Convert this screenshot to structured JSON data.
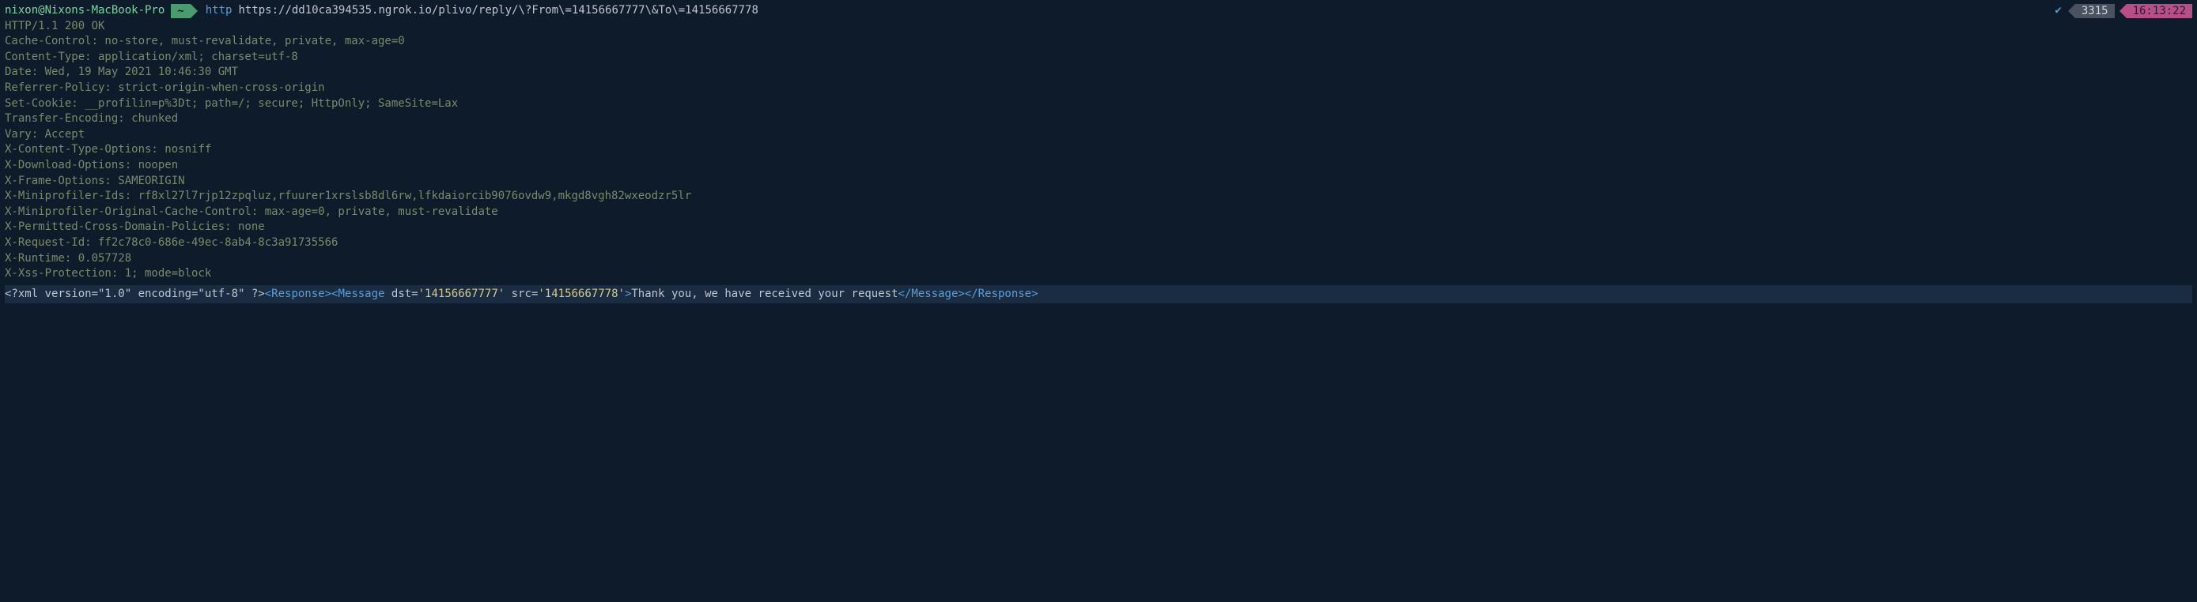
{
  "prompt": {
    "userhost": "nixon@Nixons-MacBook-Pro",
    "cwd": "~",
    "command": "http",
    "url": "https://dd10ca394535.ngrok.io/plivo/reply/\\?From\\=14156667777\\&To\\=14156667778",
    "check": "✔",
    "session_id": "3315",
    "time": "16:13:22"
  },
  "headers": {
    "status": "HTTP/1.1 200 OK",
    "cache_control": "Cache-Control: no-store, must-revalidate, private, max-age=0",
    "content_type": "Content-Type: application/xml; charset=utf-8",
    "date": "Date: Wed, 19 May 2021 10:46:30 GMT",
    "referrer_policy": "Referrer-Policy: strict-origin-when-cross-origin",
    "set_cookie": "Set-Cookie: __profilin=p%3Dt; path=/; secure; HttpOnly; SameSite=Lax",
    "transfer_encoding": "Transfer-Encoding: chunked",
    "vary": "Vary: Accept",
    "x_content_type_options": "X-Content-Type-Options: nosniff",
    "x_download_options": "X-Download-Options: noopen",
    "x_frame_options": "X-Frame-Options: SAMEORIGIN",
    "x_miniprofiler_ids": "X-Miniprofiler-Ids: rf8xl27l7rjp12zpqluz,rfuurer1xrslsb8dl6rw,lfkdaiorcib9076ovdw9,mkgd8vgh82wxeodzr5lr",
    "x_miniprofiler_original_cache_control": "X-Miniprofiler-Original-Cache-Control: max-age=0, private, must-revalidate",
    "x_permitted_cross_domain_policies": "X-Permitted-Cross-Domain-Policies: none",
    "x_request_id": "X-Request-Id: ff2c78c0-686e-49ec-8ab4-8c3a91735566",
    "x_runtime": "X-Runtime: 0.057728",
    "x_xss_protection": "X-Xss-Protection: 1; mode=block"
  },
  "xml": {
    "declaration": "<?xml version=\"1.0\" encoding=\"utf-8\" ?>",
    "response_open": "<Response>",
    "message_open": "<Message",
    "dst_attr": " dst=",
    "dst_val": "'14156667777'",
    "src_attr": " src=",
    "src_val": "'14156667778'",
    "close_angle": ">",
    "body": "Thank you, we have received your request",
    "message_close": "</Message>",
    "response_close": "</Response>"
  }
}
